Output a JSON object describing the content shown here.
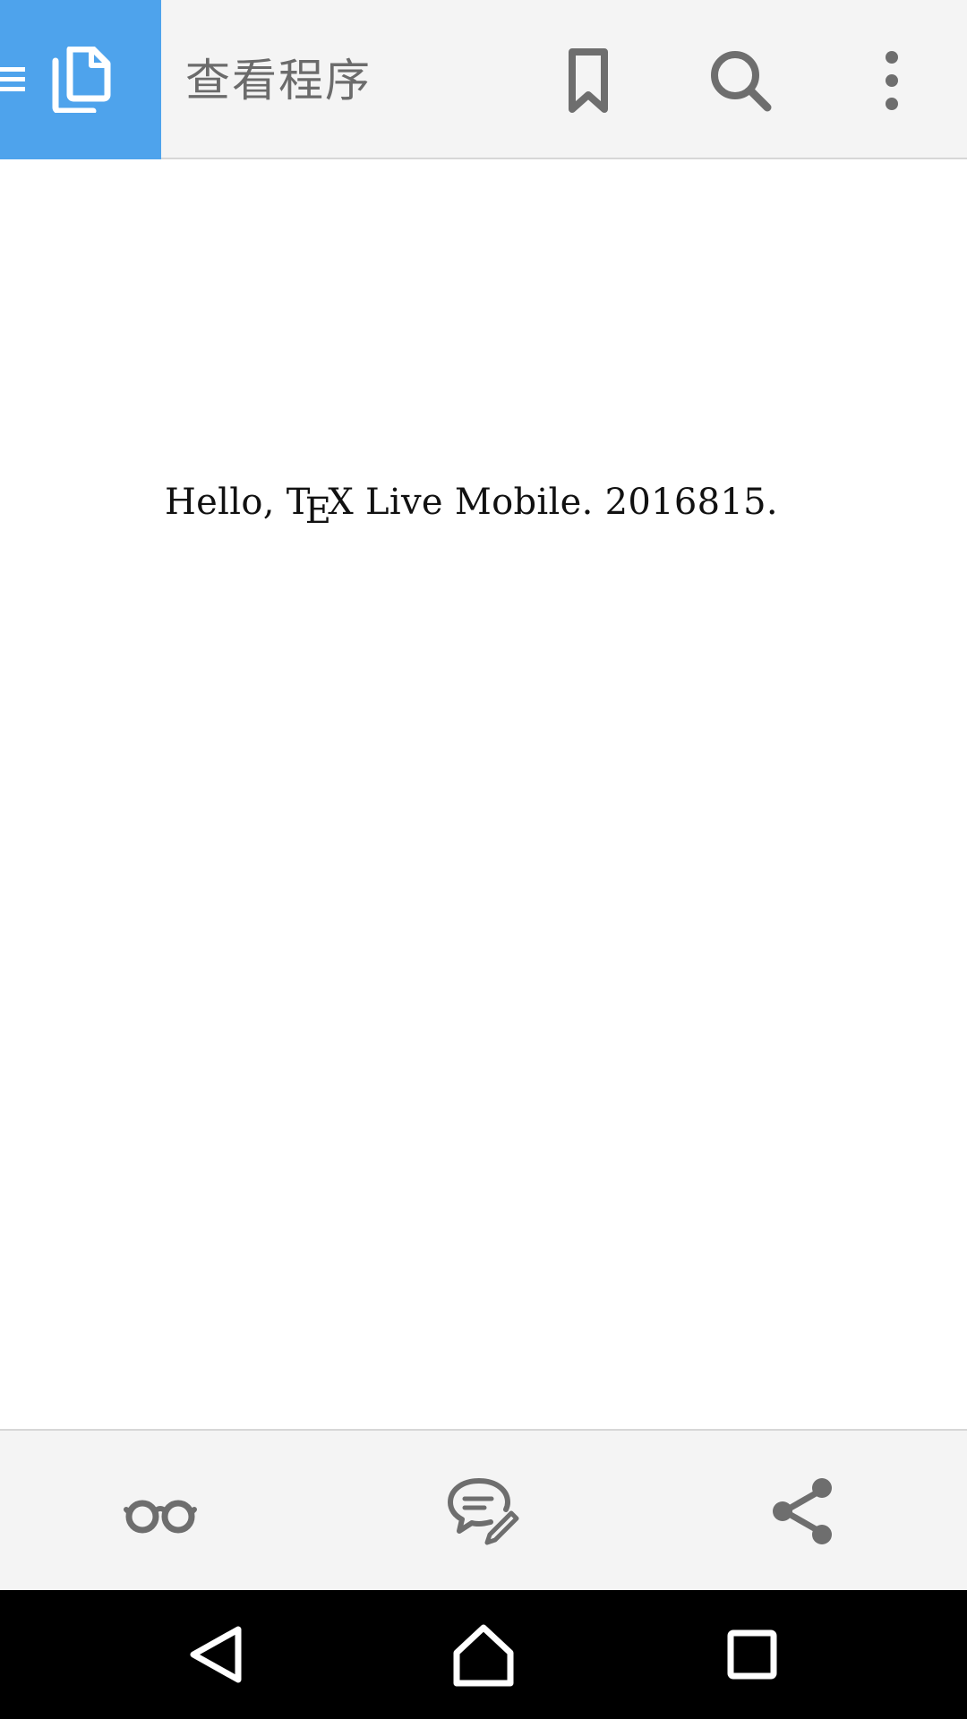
{
  "toolbar": {
    "title": "查看程序",
    "accent_color": "#4ea3ec",
    "icons": [
      "menu-icon",
      "files-icon",
      "bookmark-icon",
      "search-icon",
      "more-vert-icon"
    ]
  },
  "document": {
    "text_before": "Hello, T",
    "text_e": "E",
    "text_after": "X Live Mobile. 2016815."
  },
  "bottom_bar": {
    "icons": [
      "reading-mode-icon",
      "annotate-icon",
      "share-icon"
    ]
  },
  "navbar": {
    "icons": [
      "back-icon",
      "home-icon",
      "recent-apps-icon"
    ]
  }
}
